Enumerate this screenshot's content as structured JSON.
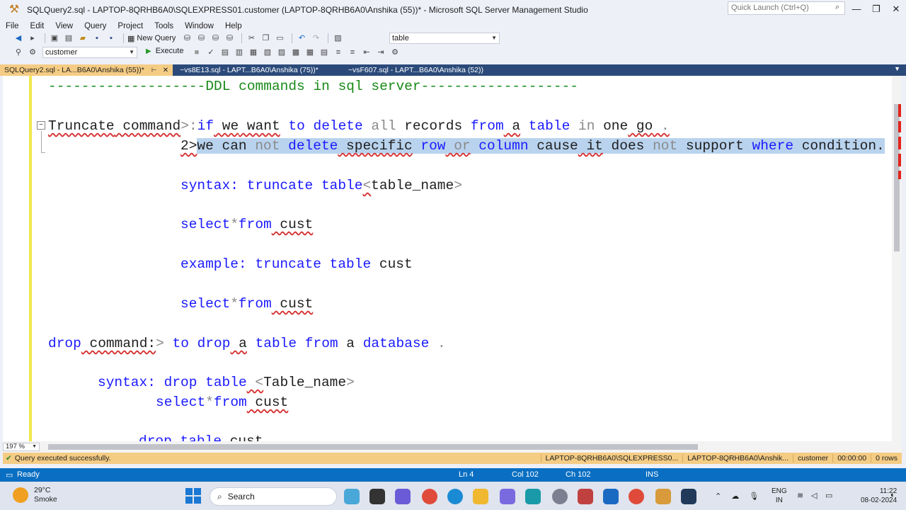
{
  "window": {
    "title": "SQLQuery2.sql - LAPTOP-8QRHB6A0\\SQLEXPRESS01.customer (LAPTOP-8QRHB6A0\\Anshika (55))* - Microsoft SQL Server Management Studio",
    "quick_launch_placeholder": "Quick Launch (Ctrl+Q)",
    "minimize": "—",
    "maximize": "❐",
    "close": "✕"
  },
  "menu": [
    "File",
    "Edit",
    "View",
    "Query",
    "Project",
    "Tools",
    "Window",
    "Help"
  ],
  "toolbar": {
    "new_query": "New Query",
    "object_combo": "table",
    "database_combo": "customer",
    "execute": "Execute"
  },
  "tabs": [
    {
      "label": "SQLQuery2.sql - LA...B6A0\\Anshika (55))*",
      "pin": "⊢",
      "close": "✕"
    },
    {
      "label": "~vs8E13.sql - LAPT...B6A0\\Anshika (75))*"
    },
    {
      "label": "~vsF607.sql - LAPT...B6A0\\Anshika (52))"
    }
  ],
  "editor": {
    "line1": "-------------------DDL commands in sql server-------------------",
    "line2": {
      "a": "Truncate",
      "b": " command",
      "c": ">:",
      "d": "if",
      "e": " we",
      "f": " want",
      "g": " to",
      "h": " delete",
      "i": " all",
      "j": " records",
      "k": " from",
      "l": " a",
      "m": " table",
      "n": " in",
      "o": " one",
      "p": " go",
      "q": " ."
    },
    "line3": {
      "prefix": "2>",
      "a": "we",
      "b": " can",
      "c": " not",
      "d": " delete",
      "e": " specific",
      "f": " row",
      "g": " or",
      "h": " column",
      "i": " cause",
      "j": " it",
      "k": " does",
      "l": " not",
      "m": " support",
      "n": " where",
      "o": " condition."
    },
    "line4": {
      "a": "syntax:",
      "b": " truncate",
      "c": " table",
      "d": "<",
      "e": "table_name",
      "f": ">"
    },
    "line5": {
      "a": "select",
      "b": "*",
      "c": "from",
      "d": " cust"
    },
    "line6": {
      "a": "example:",
      "b": " truncate",
      "c": " table",
      "d": " cust"
    },
    "line7": {
      "a": "select",
      "b": "*",
      "c": "from",
      "d": " cust"
    },
    "line8": {
      "a": "drop",
      "b": " command:",
      "c": ">",
      "d": " to",
      "e": " drop",
      "f": " a",
      "g": " table",
      "h": " from",
      "i": " a",
      "j": " database",
      "k": " ."
    },
    "line9": {
      "a": "syntax:",
      "b": " drop",
      "c": " table",
      "d": " <",
      "e": "Table_name",
      "f": ">"
    },
    "line10": {
      "a": "select",
      "b": "*",
      "c": "from",
      "d": " cust"
    },
    "line11": {
      "a": "drop",
      "b": " table",
      "c": " cust"
    }
  },
  "zoom": "197 %",
  "query_status": {
    "message": "Query executed successfully.",
    "server": "LAPTOP-8QRHB6A0\\SQLEXPRESS0...",
    "user": "LAPTOP-8QRHB6A0\\Anshik...",
    "database": "customer",
    "elapsed": "00:00:00",
    "rows": "0 rows"
  },
  "status": {
    "ready": "Ready",
    "ln": "Ln 4",
    "col": "Col 102",
    "ch": "Ch 102",
    "mode": "INS"
  },
  "taskbar": {
    "temp": "29°C",
    "weather": "Smoke",
    "search": "Search",
    "lang1": "ENG",
    "lang2": "IN",
    "time": "11:22",
    "date": "08-02-2024"
  },
  "colors": {
    "accent_tab": "#f5cc84",
    "status_blue": "#0a6fc2",
    "keyword": "#1a1aff",
    "comment": "#178a17",
    "selection": "#b9d3ee"
  }
}
